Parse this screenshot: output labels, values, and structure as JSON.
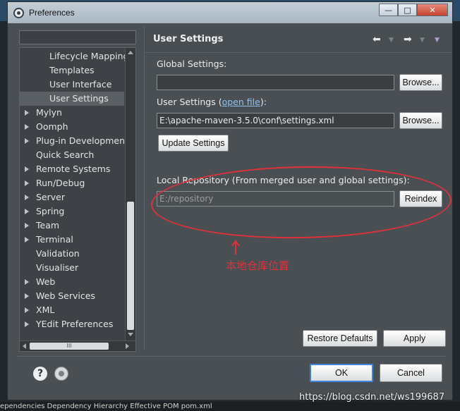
{
  "window": {
    "title": "Preferences"
  },
  "window_buttons": {
    "minimize": "—",
    "maximize": "□",
    "close": "✕"
  },
  "filter": {
    "value": ""
  },
  "tree": {
    "items": [
      {
        "label": "Lifecycle Mapping",
        "level": 2,
        "expandable": false,
        "selected": false
      },
      {
        "label": "Templates",
        "level": 2,
        "expandable": false,
        "selected": false
      },
      {
        "label": "User Interface",
        "level": 2,
        "expandable": false,
        "selected": false
      },
      {
        "label": "User Settings",
        "level": 2,
        "expandable": false,
        "selected": true
      },
      {
        "label": "Mylyn",
        "level": 1,
        "expandable": true,
        "selected": false
      },
      {
        "label": "Oomph",
        "level": 1,
        "expandable": true,
        "selected": false
      },
      {
        "label": "Plug-in Development",
        "level": 1,
        "expandable": true,
        "selected": false
      },
      {
        "label": "Quick Search",
        "level": 1,
        "expandable": false,
        "selected": false
      },
      {
        "label": "Remote Systems",
        "level": 1,
        "expandable": true,
        "selected": false
      },
      {
        "label": "Run/Debug",
        "level": 1,
        "expandable": true,
        "selected": false
      },
      {
        "label": "Server",
        "level": 1,
        "expandable": true,
        "selected": false
      },
      {
        "label": "Spring",
        "level": 1,
        "expandable": true,
        "selected": false
      },
      {
        "label": "Team",
        "level": 1,
        "expandable": true,
        "selected": false
      },
      {
        "label": "Terminal",
        "level": 1,
        "expandable": true,
        "selected": false
      },
      {
        "label": "Validation",
        "level": 1,
        "expandable": false,
        "selected": false
      },
      {
        "label": "Visualiser",
        "level": 1,
        "expandable": false,
        "selected": false
      },
      {
        "label": "Web",
        "level": 1,
        "expandable": true,
        "selected": false
      },
      {
        "label": "Web Services",
        "level": 1,
        "expandable": true,
        "selected": false
      },
      {
        "label": "XML",
        "level": 1,
        "expandable": true,
        "selected": false
      },
      {
        "label": "YEdit Preferences",
        "level": 1,
        "expandable": true,
        "selected": false
      }
    ],
    "hscroll_grip": "III"
  },
  "page": {
    "title": "User Settings",
    "global_settings_label": "Global Settings:",
    "global_settings_value": "",
    "browse_label": "Browse...",
    "user_settings_label_pre": "User Settings (",
    "user_settings_link": "open file",
    "user_settings_label_post": "):",
    "user_settings_value": "E:\\apache-maven-3.5.0\\conf\\settings.xml",
    "update_settings_label": "Update Settings",
    "local_repo_label": "Local Repository (From merged user and global settings):",
    "local_repo_value": "E:/repository",
    "reindex_label": "Reindex",
    "restore_defaults_label": "Restore Defaults",
    "apply_label": "Apply"
  },
  "footer": {
    "help_glyph": "?",
    "ok_label": "OK",
    "cancel_label": "Cancel"
  },
  "annotation": {
    "text": "本地仓库位置",
    "color": "#e0313a"
  },
  "watermark": "https://blog.csdn.net/ws199687",
  "taskbar": "ependencies  Dependency Hierarchy  Effective POM  pom.xml"
}
